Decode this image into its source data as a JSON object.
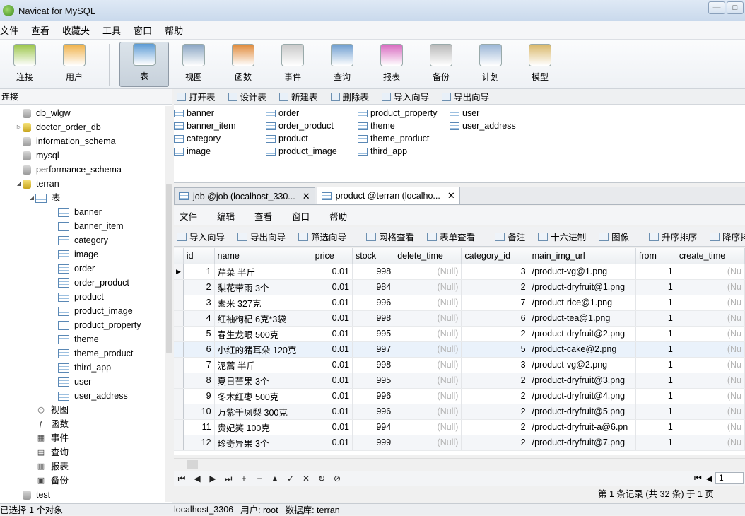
{
  "window": {
    "title": "Navicat for MySQL"
  },
  "menu": [
    "文件",
    "查看",
    "收藏夹",
    "工具",
    "窗口",
    "帮助"
  ],
  "toolbar": [
    {
      "label": "连接",
      "icon": "connection-icon",
      "color": "#9cc64a"
    },
    {
      "label": "用户",
      "icon": "user-icon",
      "color": "#f0b24a"
    },
    {
      "label": "表",
      "icon": "table-icon",
      "color": "#5b9bd5",
      "active": true
    },
    {
      "label": "视图",
      "icon": "view-icon",
      "color": "#8aa6c4"
    },
    {
      "label": "函数",
      "icon": "function-icon",
      "color": "#e08a3a"
    },
    {
      "label": "事件",
      "icon": "event-icon",
      "color": "#c9c9c9"
    },
    {
      "label": "查询",
      "icon": "query-icon",
      "color": "#6e9ed0"
    },
    {
      "label": "报表",
      "icon": "report-icon",
      "color": "#d86ac0"
    },
    {
      "label": "备份",
      "icon": "backup-icon",
      "color": "#b9b9b9"
    },
    {
      "label": "计划",
      "icon": "schedule-icon",
      "color": "#9bb6d6"
    },
    {
      "label": "模型",
      "icon": "model-icon",
      "color": "#d9b86a"
    }
  ],
  "connections": {
    "header": "连接"
  },
  "tree": [
    {
      "label": "db_wlgw",
      "type": "db",
      "indent": 1
    },
    {
      "label": "doctor_order_db",
      "type": "db-open",
      "indent": 1,
      "arrow": "▷"
    },
    {
      "label": "information_schema",
      "type": "db",
      "indent": 1
    },
    {
      "label": "mysql",
      "type": "db",
      "indent": 1
    },
    {
      "label": "performance_schema",
      "type": "db",
      "indent": 1
    },
    {
      "label": "terran",
      "type": "db-open",
      "indent": 1,
      "arrow": "◢"
    },
    {
      "label": "表",
      "type": "table",
      "indent": 2,
      "arrow": "◢"
    },
    {
      "label": "banner",
      "type": "table",
      "indent": 3
    },
    {
      "label": "banner_item",
      "type": "table",
      "indent": 3
    },
    {
      "label": "category",
      "type": "table",
      "indent": 3
    },
    {
      "label": "image",
      "type": "table",
      "indent": 3
    },
    {
      "label": "order",
      "type": "table",
      "indent": 3
    },
    {
      "label": "order_product",
      "type": "table",
      "indent": 3
    },
    {
      "label": "product",
      "type": "table",
      "indent": 3
    },
    {
      "label": "product_image",
      "type": "table",
      "indent": 3
    },
    {
      "label": "product_property",
      "type": "table",
      "indent": 3
    },
    {
      "label": "theme",
      "type": "table",
      "indent": 3
    },
    {
      "label": "theme_product",
      "type": "table",
      "indent": 3
    },
    {
      "label": "third_app",
      "type": "table",
      "indent": 3
    },
    {
      "label": "user",
      "type": "table",
      "indent": 3
    },
    {
      "label": "user_address",
      "type": "table",
      "indent": 3
    },
    {
      "label": "视图",
      "type": "other",
      "glyph": "◎",
      "indent": 2
    },
    {
      "label": "函数",
      "type": "other",
      "glyph": "ƒ",
      "indent": 2
    },
    {
      "label": "事件",
      "type": "other",
      "glyph": "▦",
      "indent": 2
    },
    {
      "label": "查询",
      "type": "other",
      "glyph": "▤",
      "indent": 2
    },
    {
      "label": "报表",
      "type": "other",
      "glyph": "▥",
      "indent": 2
    },
    {
      "label": "备份",
      "type": "other",
      "glyph": "▣",
      "indent": 2
    },
    {
      "label": "test",
      "type": "db",
      "indent": 1
    }
  ],
  "object_toolbar": [
    "打开表",
    "设计表",
    "新建表",
    "删除表",
    "导入向导",
    "导出向导"
  ],
  "object_list": [
    [
      "banner",
      "banner_item",
      "category",
      "image"
    ],
    [
      "order",
      "order_product",
      "product",
      "product_image"
    ],
    [
      "product_property",
      "theme",
      "theme_product",
      "third_app"
    ],
    [
      "user",
      "user_address"
    ]
  ],
  "tabs": [
    {
      "label": "job @job (localhost_330...",
      "active": false
    },
    {
      "label": "product @terran (localho...",
      "active": true
    }
  ],
  "inner_menu": [
    "文件",
    "编辑",
    "查看",
    "窗口",
    "帮助"
  ],
  "inner_toolbar": [
    "导入向导",
    "导出向导",
    "筛选向导",
    "网格查看",
    "表单查看",
    "备注",
    "十六进制",
    "图像",
    "升序排序",
    "降序排序"
  ],
  "grid": {
    "columns": [
      "id",
      "name",
      "price",
      "stock",
      "delete_time",
      "category_id",
      "main_img_url",
      "from",
      "create_time"
    ],
    "rows": [
      [
        "1",
        "芹菜 半斤",
        "0.01",
        "998",
        "(Null)",
        "3",
        "/product-vg@1.png",
        "1",
        "(Nu"
      ],
      [
        "2",
        "梨花带雨 3个",
        "0.01",
        "984",
        "(Null)",
        "2",
        "/product-dryfruit@1.png",
        "1",
        "(Nu"
      ],
      [
        "3",
        "素米 327克",
        "0.01",
        "996",
        "(Null)",
        "7",
        "/product-rice@1.png",
        "1",
        "(Nu"
      ],
      [
        "4",
        "红袖枸杞 6克*3袋",
        "0.01",
        "998",
        "(Null)",
        "6",
        "/product-tea@1.png",
        "1",
        "(Nu"
      ],
      [
        "5",
        "春生龙眼 500克",
        "0.01",
        "995",
        "(Null)",
        "2",
        "/product-dryfruit@2.png",
        "1",
        "(Nu"
      ],
      [
        "6",
        "小红的猪耳朵 120克",
        "0.01",
        "997",
        "(Null)",
        "5",
        "/product-cake@2.png",
        "1",
        "(Nu"
      ],
      [
        "7",
        "泥蒿 半斤",
        "0.01",
        "998",
        "(Null)",
        "3",
        "/product-vg@2.png",
        "1",
        "(Nu"
      ],
      [
        "8",
        "夏日芒果 3个",
        "0.01",
        "995",
        "(Null)",
        "2",
        "/product-dryfruit@3.png",
        "1",
        "(Nu"
      ],
      [
        "9",
        "冬木红枣 500克",
        "0.01",
        "996",
        "(Null)",
        "2",
        "/product-dryfruit@4.png",
        "1",
        "(Nu"
      ],
      [
        "10",
        "万紫千凤梨 300克",
        "0.01",
        "996",
        "(Null)",
        "2",
        "/product-dryfruit@5.png",
        "1",
        "(Nu"
      ],
      [
        "11",
        "贵妃笑 100克",
        "0.01",
        "994",
        "(Null)",
        "2",
        "/product-dryfruit-a@6.pn",
        "1",
        "(Nu"
      ],
      [
        "12",
        "珍奇异果 3个",
        "0.01",
        "999",
        "(Null)",
        "2",
        "/product-dryfruit@7.png",
        "1",
        "(Nu"
      ]
    ]
  },
  "nav_buttons": [
    "⏮",
    "◀",
    "▶",
    "⏭",
    "+",
    "−",
    "▲",
    "✓",
    "✕",
    "↻",
    "⊘"
  ],
  "page": {
    "current": "1"
  },
  "record_info": "第 1 条记录 (共 32 条) 于 1 页",
  "status": {
    "left": "已选择 1 个对象",
    "connection": "localhost_3306",
    "user": "用户: root",
    "database": "数据库: terran"
  }
}
